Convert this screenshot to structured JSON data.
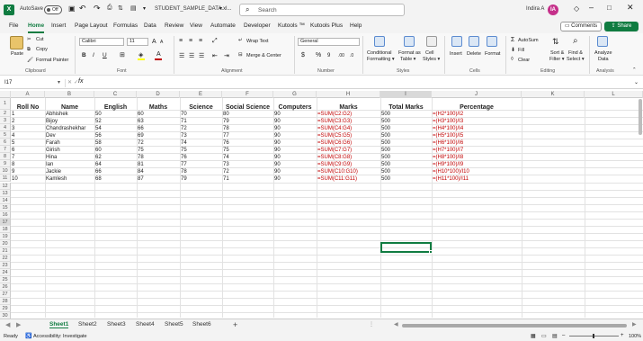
{
  "title_bar": {
    "autosave_label": "AutoSave",
    "autosave_state": "Off",
    "file_name": "STUDENT_SAMPLE_DATA.xl...",
    "search_placeholder": "Search",
    "user_name": "Indira A",
    "user_initial": "IA"
  },
  "menu": {
    "items": [
      "File",
      "Home",
      "Insert",
      "Page Layout",
      "Formulas",
      "Data",
      "Review",
      "View",
      "Automate",
      "Developer",
      "Kutools ™",
      "Kutools Plus",
      "Help"
    ],
    "active": "Home",
    "comments_label": "Comments",
    "share_label": "Share"
  },
  "ribbon": {
    "clipboard": {
      "paste": "Paste",
      "cut": "Cut",
      "copy": "Copy",
      "format_painter": "Format Painter",
      "label": "Clipboard"
    },
    "font": {
      "name": "Calibri",
      "size": "11",
      "label": "Font"
    },
    "alignment": {
      "wrap_text": "Wrap Text",
      "merge_center": "Merge & Center",
      "label": "Alignment"
    },
    "number": {
      "format": "General",
      "label": "Number"
    },
    "styles": {
      "conditional": "Conditional Formatting",
      "format_table": "Format as Table",
      "cell_styles": "Cell Styles",
      "label": "Styles"
    },
    "cells": {
      "insert": "Insert",
      "delete": "Delete",
      "format": "Format",
      "label": "Cells"
    },
    "editing": {
      "autosum": "AutoSum",
      "fill": "Fill",
      "clear": "Clear",
      "sort_filter": "Sort & Filter",
      "find_select": "Find & Select",
      "label": "Editing"
    },
    "analysis": {
      "analyze_data": "Analyze Data",
      "label": "Analysis"
    }
  },
  "formula_bar": {
    "name_box": "I17",
    "fx": "fx",
    "content": ""
  },
  "columns": [
    "A",
    "B",
    "C",
    "D",
    "E",
    "F",
    "G",
    "H",
    "I",
    "J",
    "K",
    "L"
  ],
  "rows": [
    "1",
    "2",
    "3",
    "4",
    "5",
    "6",
    "7",
    "8",
    "9",
    "10",
    "11",
    "12",
    "13",
    "14",
    "15",
    "16",
    "17",
    "18",
    "19",
    "20",
    "21",
    "22",
    "23",
    "24",
    "25",
    "26",
    "27",
    "28",
    "29",
    "30",
    "31"
  ],
  "table": {
    "headers": [
      "Roll No",
      "Name",
      "English",
      "Maths",
      "Science",
      "Social Science",
      "Computers",
      "Marks",
      "Total Marks",
      "Percentage"
    ],
    "rows": [
      [
        "1",
        "Abhishek",
        "50",
        "60",
        "70",
        "80",
        "90",
        "=SUM(C2:G2)",
        "500",
        "=(H2*100)/I2"
      ],
      [
        "2",
        "Bijoy",
        "52",
        "63",
        "71",
        "79",
        "90",
        "=SUM(C3:G3)",
        "500",
        "=(H3*100)/I3"
      ],
      [
        "3",
        "Chandrashekhar",
        "54",
        "66",
        "72",
        "78",
        "90",
        "=SUM(C4:G4)",
        "500",
        "=(H4*100)/I4"
      ],
      [
        "4",
        "Dev",
        "56",
        "69",
        "73",
        "77",
        "90",
        "=SUM(C5:G5)",
        "500",
        "=(H5*100)/I5"
      ],
      [
        "5",
        "Farah",
        "58",
        "72",
        "74",
        "76",
        "90",
        "=SUM(C6:G6)",
        "500",
        "=(H6*100)/I6"
      ],
      [
        "6",
        "Girish",
        "60",
        "75",
        "75",
        "75",
        "90",
        "=SUM(C7:G7)",
        "500",
        "=(H7*100)/I7"
      ],
      [
        "7",
        "Hina",
        "62",
        "78",
        "76",
        "74",
        "90",
        "=SUM(C8:G8)",
        "500",
        "=(H8*100)/I8"
      ],
      [
        "8",
        "Ian",
        "64",
        "81",
        "77",
        "73",
        "90",
        "=SUM(C9:G9)",
        "500",
        "=(H9*100)/I9"
      ],
      [
        "9",
        "Jackie",
        "66",
        "84",
        "78",
        "72",
        "90",
        "=SUM(C10:G10)",
        "500",
        "=(H10*100)/I10"
      ],
      [
        "10",
        "Kamlesh",
        "68",
        "87",
        "79",
        "71",
        "90",
        "=SUM(C11:G11)",
        "500",
        "=(H11*100)/I11"
      ]
    ]
  },
  "sheets": [
    "Sheet1",
    "Sheet2",
    "Sheet3",
    "Sheet4",
    "Sheet5",
    "Sheet6"
  ],
  "active_sheet": "Sheet1",
  "status": {
    "ready": "Ready",
    "accessibility": "Accessibility: Investigate",
    "zoom": "100%"
  },
  "colors": {
    "accent": "#107c41",
    "formula_text": "#c00000"
  }
}
